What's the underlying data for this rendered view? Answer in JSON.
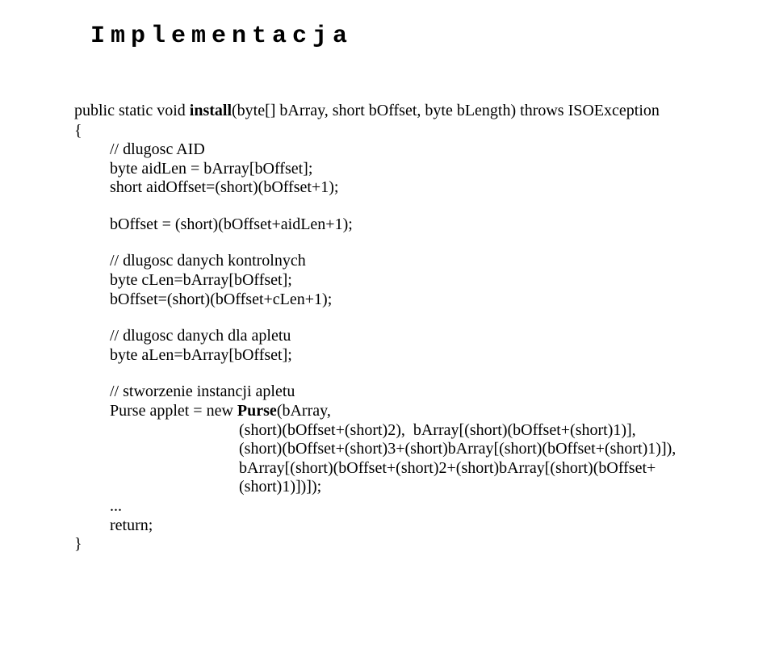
{
  "title": "Implementacja",
  "sig": {
    "prefix": "public static void ",
    "name": "install",
    "params": "(byte[] bArray, short bOffset, byte bLength) throws ISOException"
  },
  "open_brace": "{",
  "body": {
    "c1": "// dlugosc AID",
    "l1": "byte aidLen = bArray[bOffset];",
    "l2": "short aidOffset=(short)(bOffset+1);",
    "l3": "bOffset = (short)(bOffset+aidLen+1);",
    "c2": "// dlugosc danych kontrolnych",
    "l4": "byte cLen=bArray[bOffset];",
    "l5": "bOffset=(short)(bOffset+cLen+1);",
    "c3": "// dlugosc danych dla apletu",
    "l6": "byte aLen=bArray[bOffset];",
    "c4": "// stworzenie instancji apletu",
    "l7a": "Purse applet = new ",
    "l7b": "Purse",
    "l7c": "(bArray,",
    "l8": "(short)(bOffset+(short)2),  bArray[(short)(bOffset+(short)1)],",
    "l9": "(short)(bOffset+(short)3+(short)bArray[(short)(bOffset+(short)1)]),",
    "l10": "bArray[(short)(bOffset+(short)2+(short)bArray[(short)(bOffset+(short)1)])]);",
    "dots": "...",
    "ret": "return;"
  },
  "close_brace": "}"
}
